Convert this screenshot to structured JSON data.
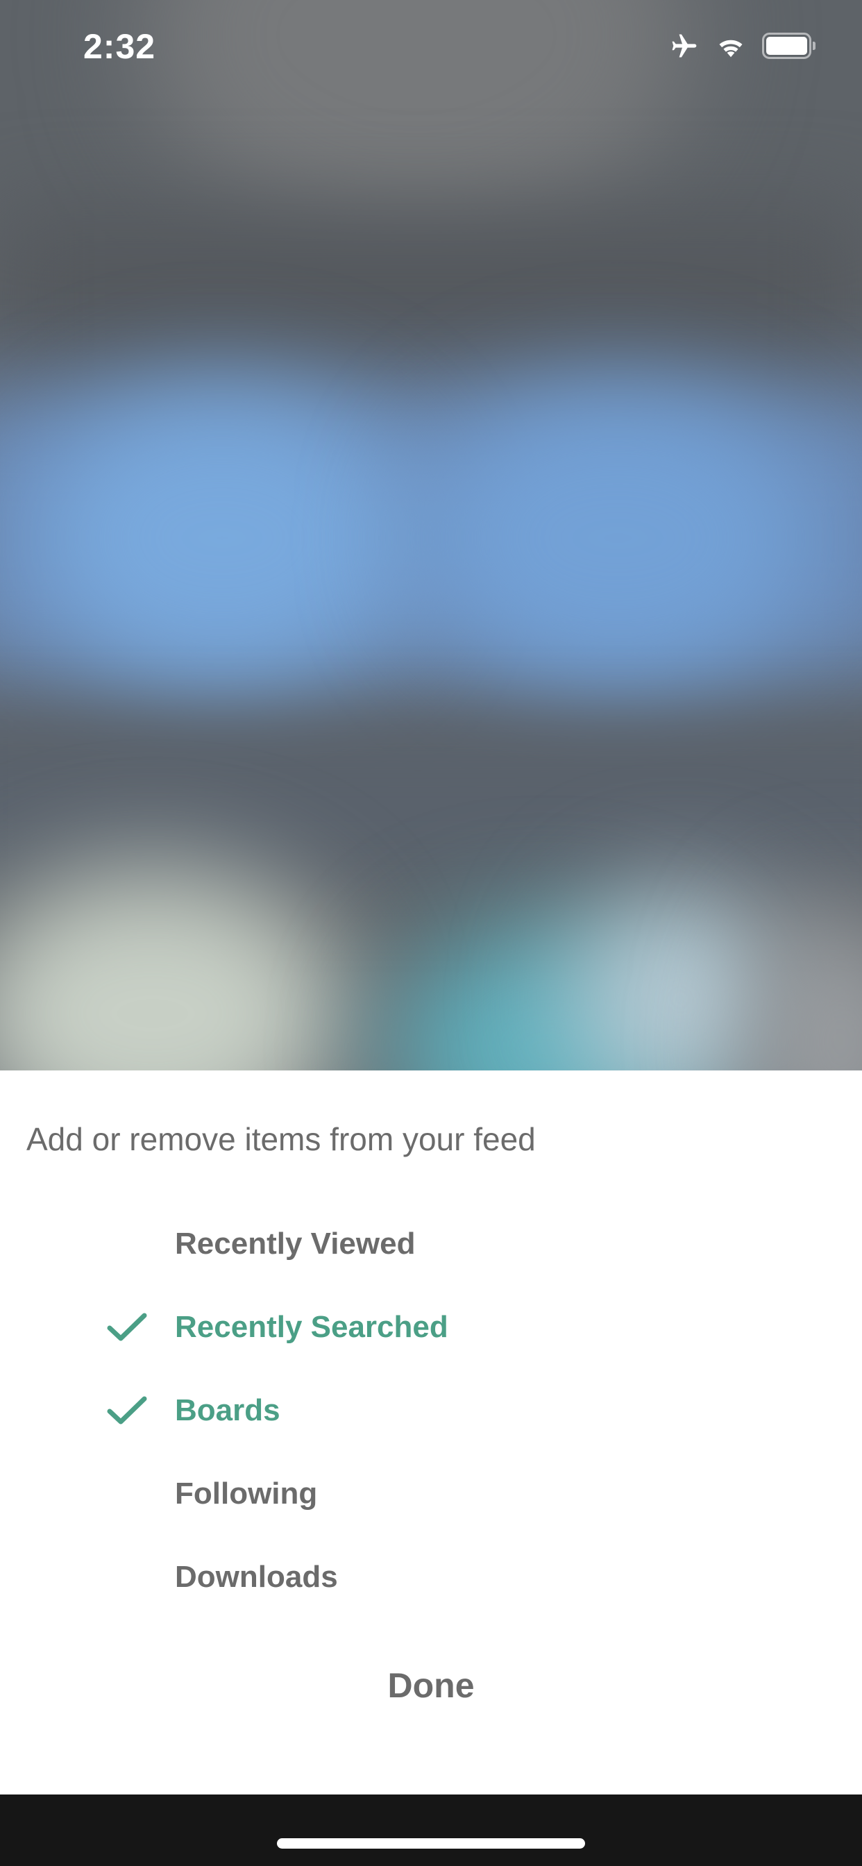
{
  "status_bar": {
    "time": "2:32",
    "icons": [
      "airplane-icon",
      "wifi-icon",
      "battery-icon"
    ]
  },
  "sheet": {
    "heading": "Add or remove items from your feed",
    "items": [
      {
        "label": "Recently Viewed",
        "checked": false
      },
      {
        "label": "Recently Searched",
        "checked": true
      },
      {
        "label": "Boards",
        "checked": true
      },
      {
        "label": "Following",
        "checked": false
      },
      {
        "label": "Downloads",
        "checked": false
      }
    ],
    "done_label": "Done"
  },
  "colors": {
    "accent": "#4b9f86",
    "text_muted": "#6b6b6b",
    "sheet_background": "#ffffff",
    "home_bar_background": "#161616"
  }
}
